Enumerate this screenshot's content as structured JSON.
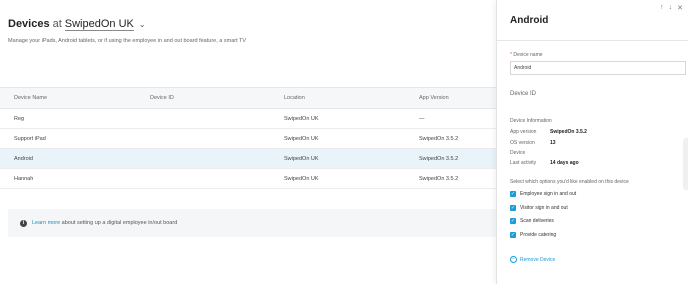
{
  "header": {
    "title": "Devices",
    "at": "at",
    "organization": "SwipedOn UK",
    "subtitle": "Manage your iPads, Android tablets, or if using the employee in and out board feature, a smart TV"
  },
  "table": {
    "columns": [
      "Device Name",
      "Device ID",
      "Location",
      "App Version"
    ],
    "rows": [
      {
        "name": "Reg",
        "device_id": "",
        "location": "SwipedOn UK",
        "app_version": "—"
      },
      {
        "name": "Support iPad",
        "device_id": "",
        "location": "SwipedOn UK",
        "app_version": "SwipedOn 3.5.2"
      },
      {
        "name": "Android",
        "device_id": "",
        "location": "SwipedOn UK",
        "app_version": "SwipedOn 3.5.2"
      },
      {
        "name": "Hannah",
        "device_id": "",
        "location": "SwipedOn UK",
        "app_version": "SwipedOn 3.5.2"
      }
    ]
  },
  "info_bar": {
    "link": "Learn more",
    "text": "about setting up a digital employee in/out board"
  },
  "drawer": {
    "title": "Android",
    "icons": [
      "arrow-up-icon",
      "arrow-down-icon",
      "close-icon"
    ],
    "device_name_label": "Device name",
    "device_name_value": "Android",
    "device_id_label": "Device ID",
    "device_info_label": "Device Information",
    "info": {
      "app_version_label": "App version",
      "app_version_value": "SwipedOn 3.5.2",
      "os_version_label": "OS version",
      "os_version_value": "13",
      "device_label": "Device",
      "last_activity_label": "Last activity",
      "last_activity_value": "14 days ago"
    },
    "options_label": "Select which options you'd like enabled on this device",
    "options": [
      "Employee sign in and out",
      "Visitor sign in and out",
      "Scan deliveries",
      "Provide catering"
    ],
    "remove_label": "Remove Device"
  },
  "colors": {
    "accent": "#1b9bd7",
    "selected_row": "#e8f4fa",
    "required": "#e2453c"
  }
}
